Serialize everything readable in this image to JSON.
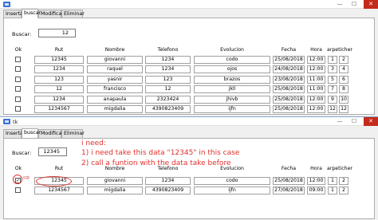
{
  "window1": {
    "title_bar": {
      "minimize": "—",
      "maximize": "☐",
      "close": "✕"
    },
    "tabs": [
      "Insertar",
      "buscar",
      "Modificar",
      "Eliminar"
    ],
    "active_tab": 1,
    "search": {
      "label": "Buscar:",
      "value": "12"
    },
    "headers": [
      "Ok",
      "Rut",
      "Nombre",
      "Telefono",
      "Evolucion",
      "Fecha",
      "Hora",
      "arpeticher"
    ],
    "rows": [
      {
        "checked": false,
        "rut": "12345",
        "nombre": "giovanni",
        "telefono": "1234",
        "evolucion": "codo",
        "fecha": "25/08/2018",
        "hora": "12:00",
        "extra": [
          "1",
          "2"
        ]
      },
      {
        "checked": false,
        "rut": "1234",
        "nombre": "raquel",
        "telefono": "1234",
        "evolucion": "ojos",
        "fecha": "24/08/2018",
        "hora": "12:00",
        "extra": [
          "3",
          "4"
        ]
      },
      {
        "checked": false,
        "rut": "123",
        "nombre": "yasnir",
        "telefono": "123",
        "evolucion": "brazos",
        "fecha": "23/08/2018",
        "hora": "11:00",
        "extra": [
          "5",
          "6"
        ]
      },
      {
        "checked": false,
        "rut": "12",
        "nombre": "francisco",
        "telefono": "12",
        "evolucion": "jkll",
        "fecha": "25/08/2018",
        "hora": "11:00",
        "extra": [
          "7",
          "8"
        ]
      },
      {
        "checked": false,
        "rut": "1234",
        "nombre": "anapaula",
        "telefono": "2323424",
        "evolucion": "jhivb",
        "fecha": "25/08/2018",
        "hora": "12:00",
        "extra": [
          "9",
          "10"
        ]
      },
      {
        "checked": false,
        "rut": "1234567",
        "nombre": "migdalia",
        "telefono": "4390823409",
        "evolucion": "ijfn",
        "fecha": "25/08/2018",
        "hora": "12:00",
        "extra": [
          "12",
          "12"
        ]
      }
    ]
  },
  "window2": {
    "title": "tk",
    "title_bar": {
      "minimize": "—",
      "maximize": "☐",
      "close": "✕"
    },
    "tabs": [
      "Insertar",
      "buscar",
      "Modificar",
      "Eliminar"
    ],
    "active_tab": 1,
    "search": {
      "label": "Buscar:",
      "value": "12345"
    },
    "headers": [
      "Ok",
      "Rut",
      "Nombre",
      "Telefono",
      "Evolucion",
      "Fecha",
      "Hora",
      "arpeticher"
    ],
    "rows": [
      {
        "checked": true,
        "rut": "12345",
        "nombre": "giovanni",
        "telefono": "1234",
        "evolucion": "codo",
        "fecha": "25/08/2018",
        "hora": "12:00",
        "extra": [
          "1",
          "2"
        ]
      },
      {
        "checked": false,
        "rut": "1234567",
        "nombre": "migdalia",
        "telefono": "4390823409",
        "evolucion": "ijfn",
        "fecha": "27/08/2018",
        "hora": "09:00",
        "extra": [
          "1",
          "2"
        ]
      }
    ],
    "annotation": {
      "line1": "i need:",
      "line2": "1) i need take this data \"12345\" in this case",
      "line3": "2) call a funtion with the data take before",
      "arrow": "⇨",
      "color": "#e0302c"
    }
  }
}
